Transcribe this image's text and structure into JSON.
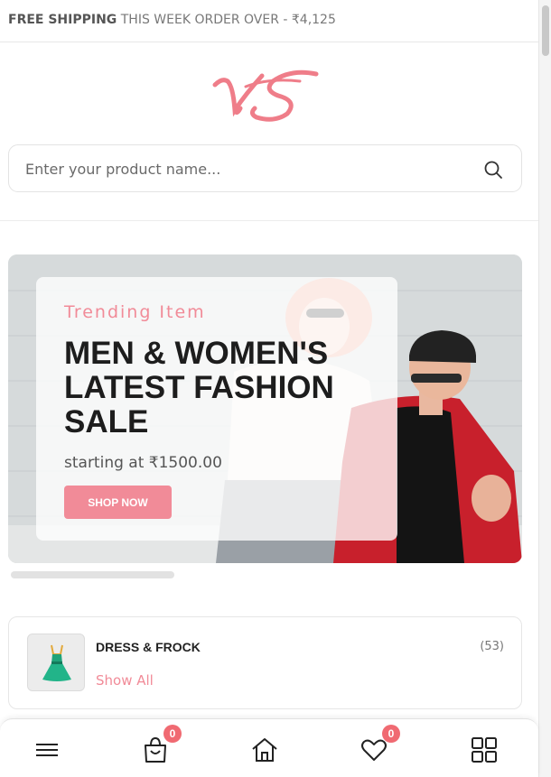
{
  "topbar": {
    "shipping_strong": "FREE SHIPPING",
    "shipping_rest": "THIS WEEK ORDER OVER - ₹4,125"
  },
  "search": {
    "placeholder": "Enter your product name..."
  },
  "banner": {
    "subtitle": "Trending Item",
    "title": "MEN & WOMEN'S\nLATEST FASHION\nSALE",
    "price_text": "starting at ₹1500.00",
    "button_label": "SHOP NOW"
  },
  "category": {
    "name": "DRESS & FROCK",
    "count": "(53)",
    "link_label": "Show All"
  },
  "bottom_nav": {
    "cart_count": "0",
    "wishlist_count": "0",
    "icons": [
      "menu-icon",
      "bag-icon",
      "home-icon",
      "heart-icon",
      "grid-icon"
    ]
  },
  "colors": {
    "accent": "#f18b98",
    "badge": "#f06a72",
    "text_dark": "#212121"
  }
}
